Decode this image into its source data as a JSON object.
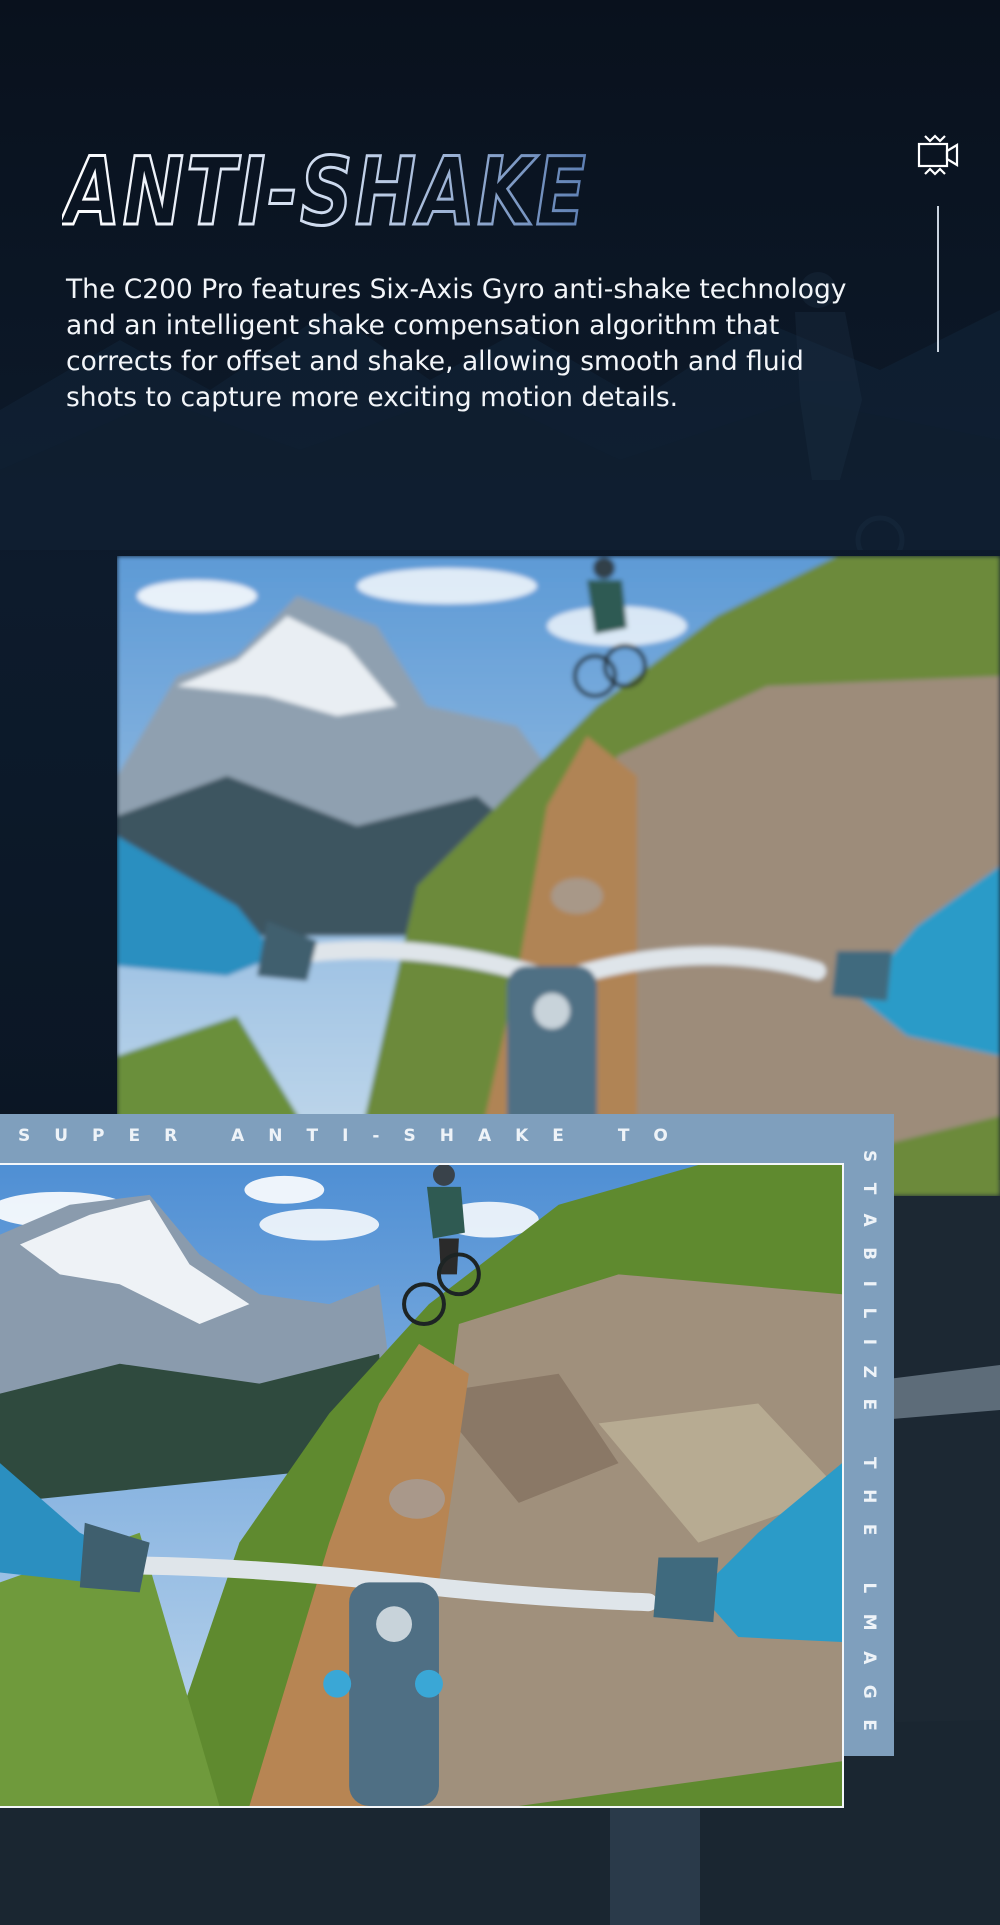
{
  "hero": {
    "title": "ANTI-SHAKE",
    "description": "The C200 Pro features Six-Axis Gyro anti-shake technology and an intelligent shake compensation algorithm that corrects for offset and shake, allowing smooth and fluid shots to capture more exciting motion details."
  },
  "banner": {
    "top_text": "SUPER ANTI-SHAKE TO",
    "side_text": "STABILIZE THE LMAGE"
  },
  "icons": {
    "camera": "video-camera-icon"
  },
  "colors": {
    "background": "#0b1626",
    "frame_accent": "#7f9fbd",
    "title_gradient_start": "#ffffff",
    "title_gradient_end": "#5d7fb3",
    "text": "#f2f5f9"
  }
}
